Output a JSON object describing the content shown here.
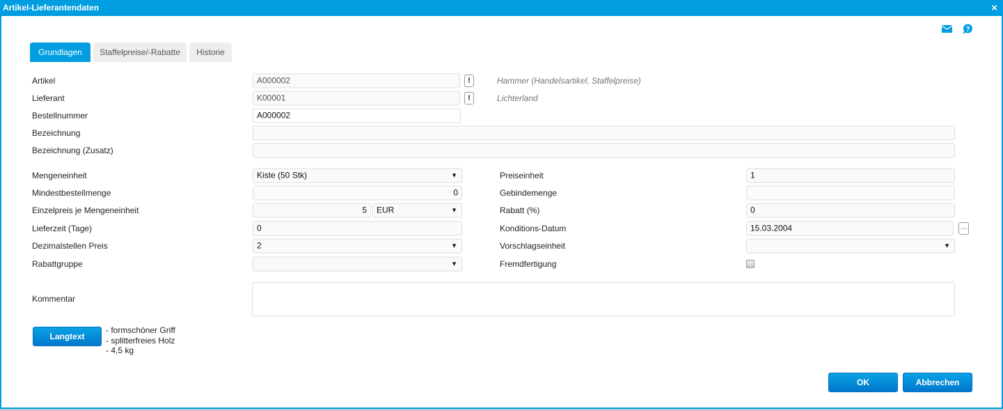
{
  "window": {
    "title": "Artikel-Lieferantendaten",
    "close": "×"
  },
  "tabs": [
    {
      "label": "Grundlagen"
    },
    {
      "label": "Staffelpreise/-Rabatte"
    },
    {
      "label": "Historie"
    }
  ],
  "fields": {
    "artikel": {
      "label": "Artikel",
      "value": "A000002",
      "hint": "Hammer (Handelsartikel, Staffelpreise)"
    },
    "lieferant": {
      "label": "Lieferant",
      "value": "K00001",
      "hint": "Lichterland"
    },
    "bestellnummer": {
      "label": "Bestellnummer",
      "value": "A000002"
    },
    "bezeichnung": {
      "label": "Bezeichnung",
      "value": ""
    },
    "bezeichnung_zusatz": {
      "label": "Bezeichnung (Zusatz)",
      "value": ""
    },
    "mengeneinheit": {
      "label": "Mengeneinheit",
      "value": "Kiste (50 Stk)"
    },
    "mindestbestellmenge": {
      "label": "Mindestbestellmenge",
      "value": "0"
    },
    "einzelpreis": {
      "label": "Einzelpreis je Mengeneinheit",
      "value": "5",
      "currency": "EUR"
    },
    "lieferzeit": {
      "label": "Lieferzeit (Tage)",
      "value": "0"
    },
    "dezimalstellen": {
      "label": "Dezimalstellen Preis",
      "value": "2"
    },
    "rabattgruppe": {
      "label": "Rabattgruppe",
      "value": ""
    },
    "preiseinheit": {
      "label": "Preiseinheit",
      "value": "1"
    },
    "gebindemenge": {
      "label": "Gebindemenge",
      "value": ""
    },
    "rabatt": {
      "label": "Rabatt (%)",
      "value": "0"
    },
    "konditionsdatum": {
      "label": "Konditions-Datum",
      "value": "15.03.2004",
      "picker": "..."
    },
    "vorschlagseinheit": {
      "label": "Vorschlagseinheit",
      "value": ""
    },
    "fremdfertigung": {
      "label": "Fremdfertigung",
      "checked": false
    },
    "kommentar": {
      "label": "Kommentar",
      "value": ""
    }
  },
  "excl": "!",
  "langtext": {
    "button": "Langtext",
    "lines": [
      "- formschöner Griff",
      "- splitterfreies Holz",
      "- 4,5 kg"
    ]
  },
  "buttons": {
    "ok": "OK",
    "cancel": "Abbrechen"
  },
  "colors": {
    "accent": "#009de0"
  }
}
